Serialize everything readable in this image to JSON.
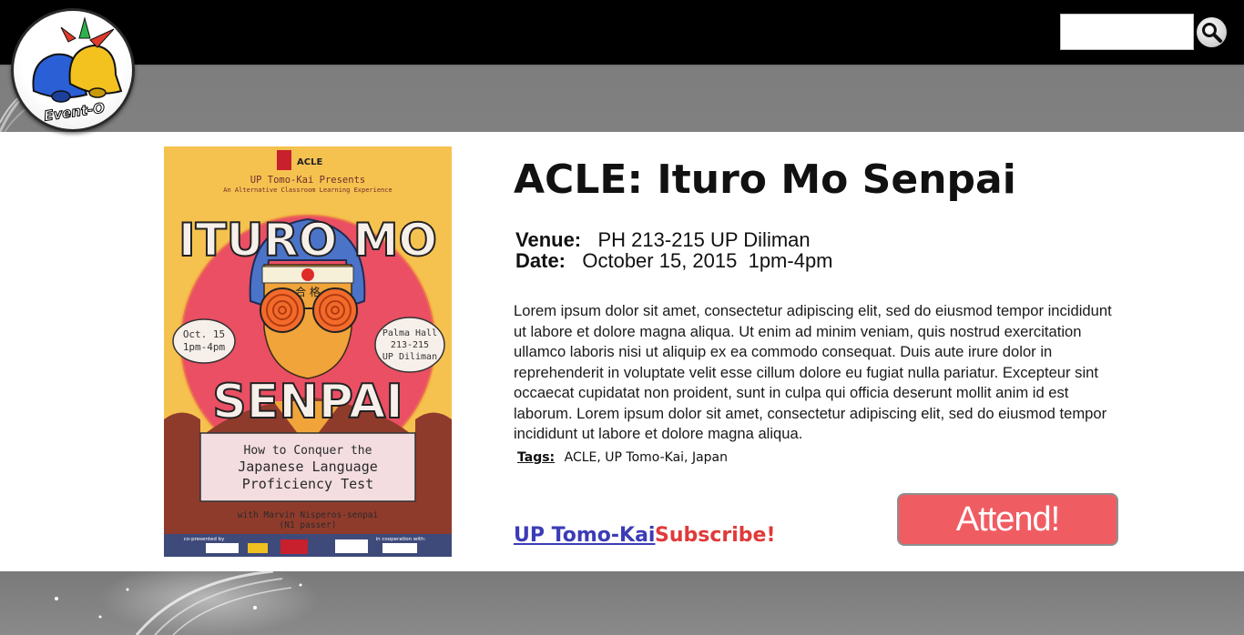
{
  "header": {
    "logo_text": "Event-O",
    "search": {
      "placeholder": "",
      "value": ""
    },
    "search_icon": "magnifier-icon"
  },
  "event": {
    "title": "ACLE: Ituro Mo Senpai",
    "venue_label": "Venue:",
    "venue": "PH 213-215 UP Diliman",
    "date_label": "Date:",
    "date": "October 15, 2015  1pm-4pm",
    "description": "Lorem ipsum dolor sit amet, consectetur adipiscing elit, sed do eiusmod tempor incididunt ut labore et dolore magna aliqua. Ut enim ad minim veniam, quis nostrud exercitation ullamco laboris nisi ut aliquip ex ea commodo consequat. Duis aute irure dolor in reprehenderit in voluptate velit esse cillum dolore eu fugiat nulla pariatur. Excepteur sint occaecat cupidatat non proident, sunt in culpa qui officia deserunt mollit anim id est laborum. Lorem ipsum dolor sit amet, consectetur adipiscing elit, sed do eiusmod tempor incididunt ut labore et dolore magna aliqua.",
    "tags_label": "Tags:",
    "tags": "ACLE, UP Tomo-Kai, Japan",
    "organizer": "UP Tomo-Kai",
    "subscribe_label": "Subscribe!",
    "attend_label": "Attend!"
  },
  "poster": {
    "top_logo": "ACLE",
    "presents": "UP Tomo-Kai Presents",
    "subtitle": "An Alternative Classroom Learning Experience",
    "title_line1": "ITURO MO",
    "title_line2": "SENPAI",
    "date_bubble_1": "Oct. 15",
    "date_bubble_2": "1pm-4pm",
    "venue_bubble_1": "Palma Hall",
    "venue_bubble_2": "213-215",
    "venue_bubble_3": "UP Diliman",
    "box_line1": "How to Conquer the",
    "box_line2": "Japanese Language",
    "box_line3": "Proficiency Test",
    "speaker_line1": "with Marvin Nisperos-senpai",
    "speaker_line2": "(N1 passer)",
    "copresented": "co-presented by",
    "cooperation": "in cooperation with:",
    "headband_text": "合 格"
  },
  "colors": {
    "accent_red": "#ef5d63",
    "link_blue": "#3c3cb7",
    "subscribe_red": "#e03a3a",
    "header_black": "#000000",
    "bar_grey": "#808080"
  }
}
